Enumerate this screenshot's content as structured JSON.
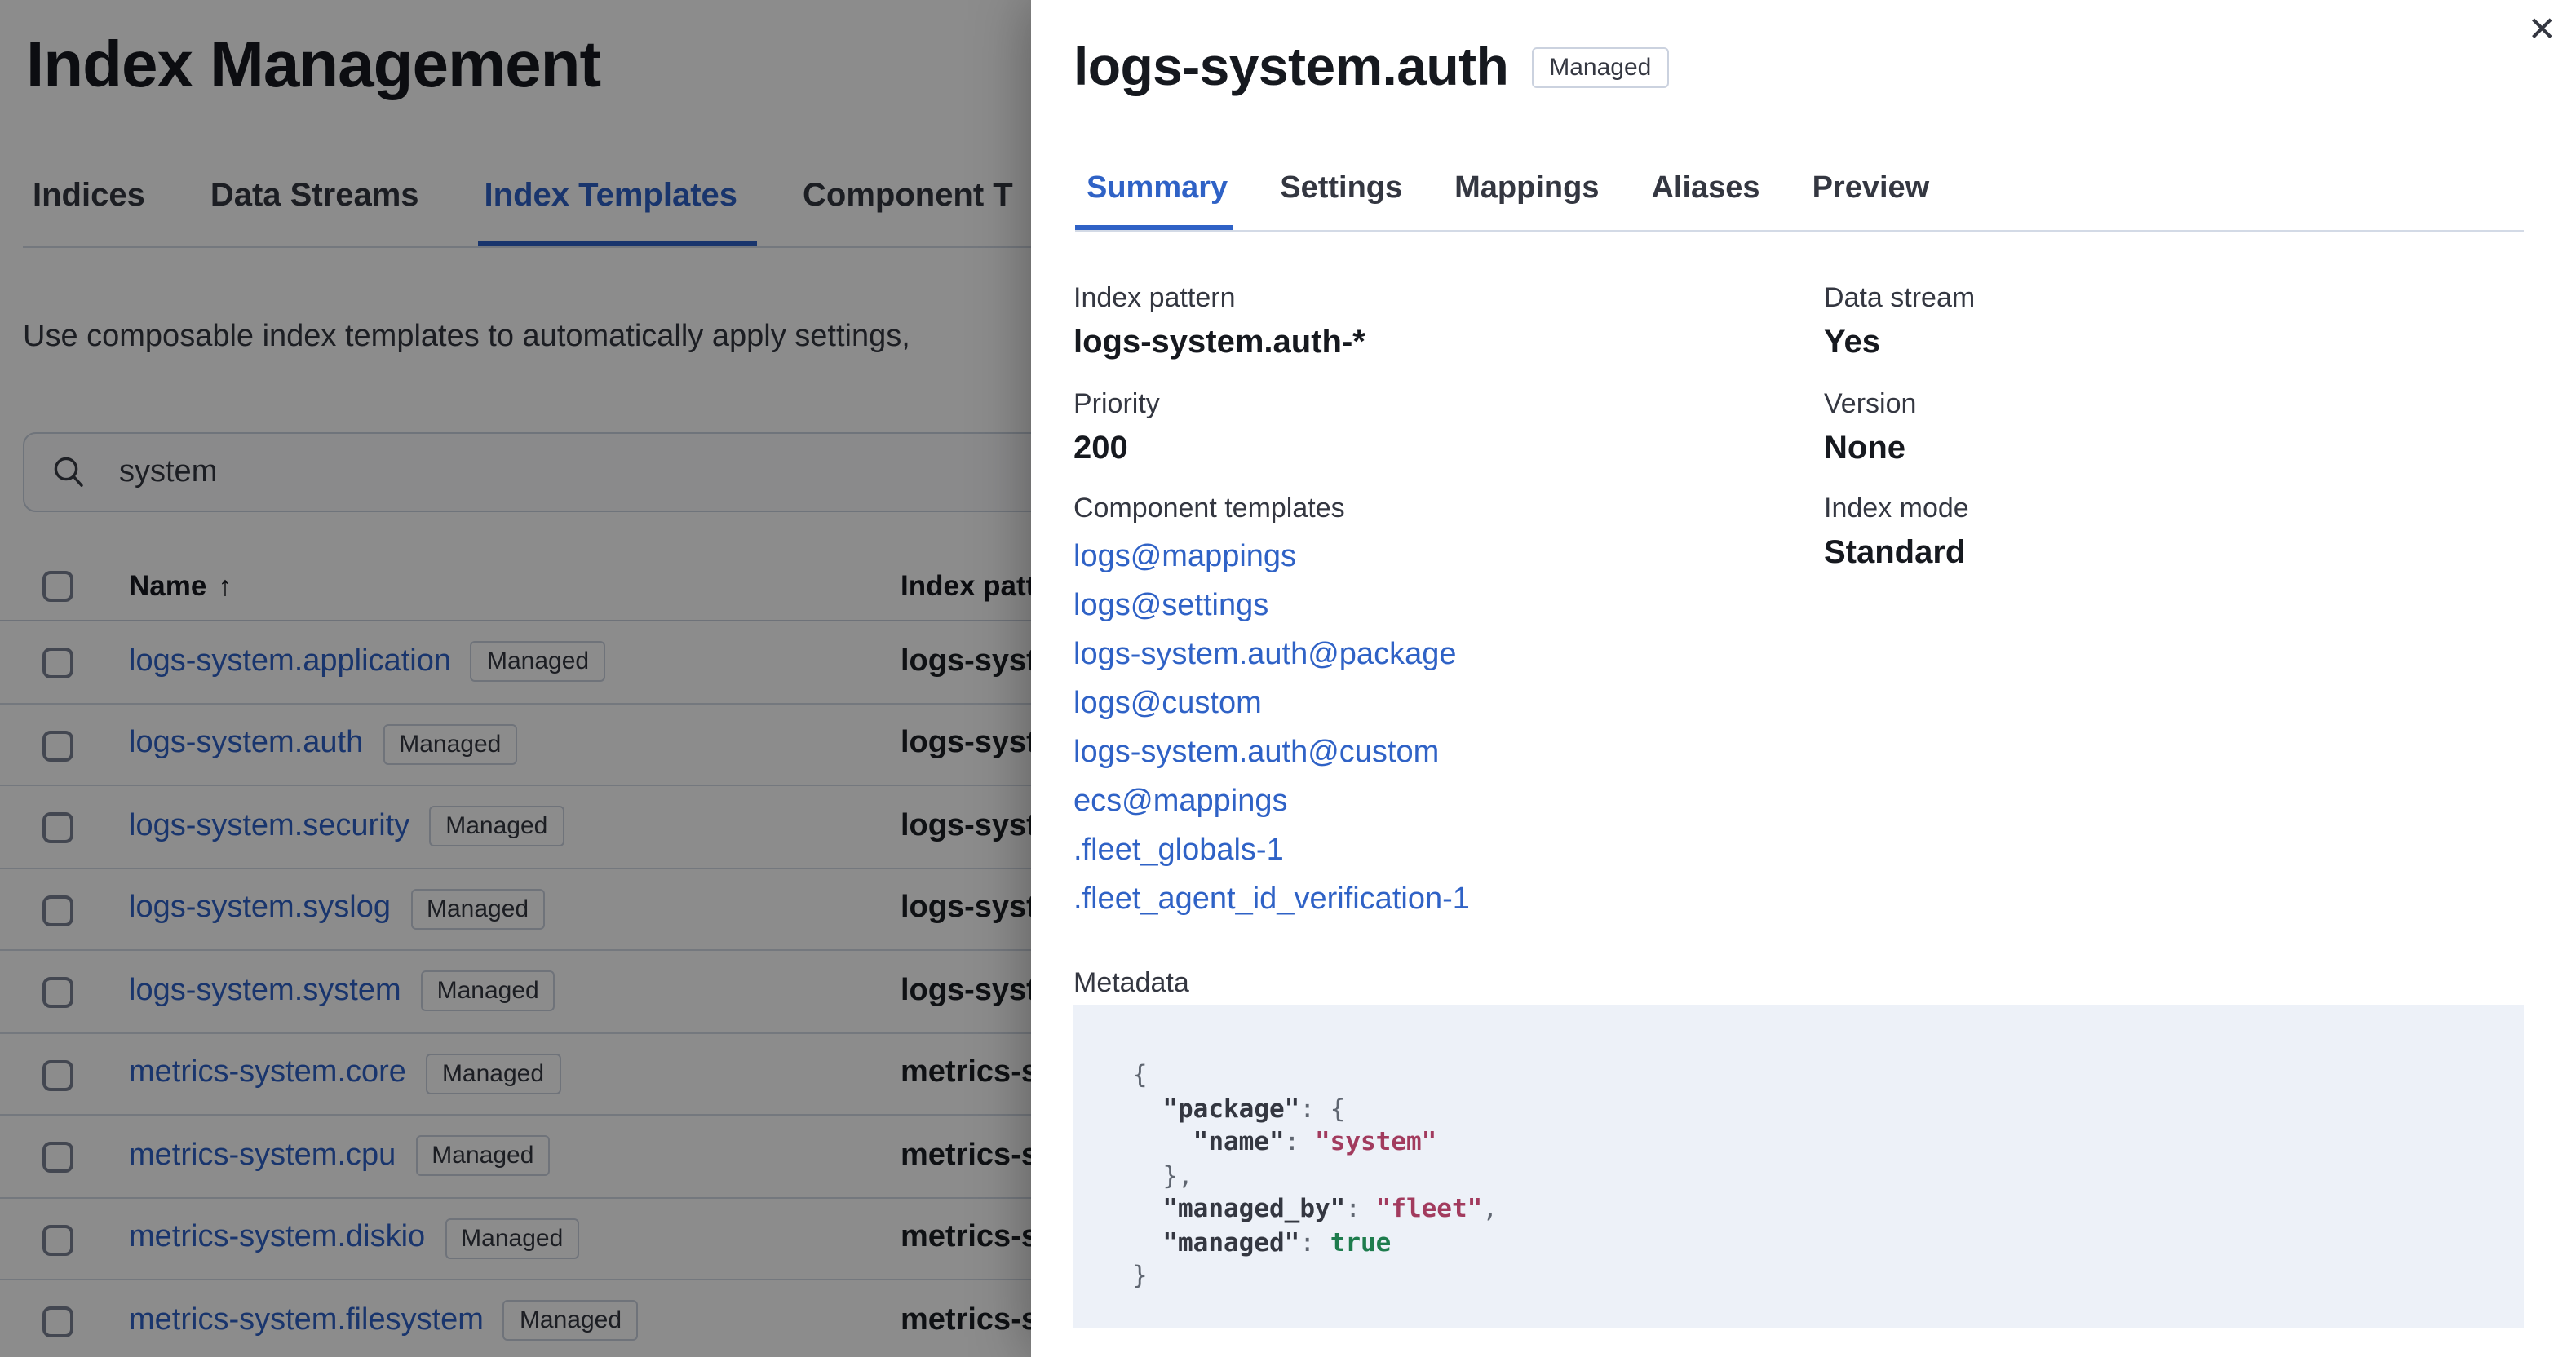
{
  "page": {
    "title": "Index Management",
    "tabs": [
      {
        "label": "Indices",
        "active": false
      },
      {
        "label": "Data Streams",
        "active": false
      },
      {
        "label": "Index Templates",
        "active": true
      },
      {
        "label": "Component T",
        "active": false
      }
    ],
    "description": "Use composable index templates to automatically apply settings,",
    "search": {
      "icon": "search-icon",
      "value": "system"
    },
    "table": {
      "columns": {
        "name": "Name",
        "index_pattern": "Index patter"
      },
      "sort_icon": "↑",
      "rows": [
        {
          "name": "logs-system.application",
          "badge": "Managed",
          "index_pattern": "logs-syste"
        },
        {
          "name": "logs-system.auth",
          "badge": "Managed",
          "index_pattern": "logs-syste"
        },
        {
          "name": "logs-system.security",
          "badge": "Managed",
          "index_pattern": "logs-syste"
        },
        {
          "name": "logs-system.syslog",
          "badge": "Managed",
          "index_pattern": "logs-syste"
        },
        {
          "name": "logs-system.system",
          "badge": "Managed",
          "index_pattern": "logs-syste"
        },
        {
          "name": "metrics-system.core",
          "badge": "Managed",
          "index_pattern": "metrics-sy"
        },
        {
          "name": "metrics-system.cpu",
          "badge": "Managed",
          "index_pattern": "metrics-sy"
        },
        {
          "name": "metrics-system.diskio",
          "badge": "Managed",
          "index_pattern": "metrics-sy"
        },
        {
          "name": "metrics-system.filesystem",
          "badge": "Managed",
          "index_pattern": "metrics-sy"
        }
      ]
    }
  },
  "flyout": {
    "close_icon": "✕",
    "title": "logs-system.auth",
    "badge": "Managed",
    "tabs": [
      {
        "label": "Summary",
        "active": true
      },
      {
        "label": "Settings",
        "active": false
      },
      {
        "label": "Mappings",
        "active": false
      },
      {
        "label": "Aliases",
        "active": false
      },
      {
        "label": "Preview",
        "active": false
      }
    ],
    "summary": {
      "index_pattern": {
        "label": "Index pattern",
        "value": "logs-system.auth-*"
      },
      "priority": {
        "label": "Priority",
        "value": "200"
      },
      "component_templates": {
        "label": "Component templates",
        "links": [
          "logs@mappings",
          "logs@settings",
          "logs-system.auth@package",
          "logs@custom",
          "logs-system.auth@custom",
          "ecs@mappings",
          ".fleet_globals-1",
          ".fleet_agent_id_verification-1"
        ]
      },
      "data_stream": {
        "label": "Data stream",
        "value": "Yes"
      },
      "version": {
        "label": "Version",
        "value": "None"
      },
      "index_mode": {
        "label": "Index mode",
        "value": "Standard"
      },
      "metadata": {
        "label": "Metadata",
        "code_lines": [
          [
            [
              "p",
              "{"
            ]
          ],
          [
            [
              "p",
              "  "
            ],
            [
              "k",
              "\"package\""
            ],
            [
              "p",
              ": {"
            ]
          ],
          [
            [
              "p",
              "    "
            ],
            [
              "k",
              "\"name\""
            ],
            [
              "p",
              ": "
            ],
            [
              "s",
              "\"system\""
            ]
          ],
          [
            [
              "p",
              "  },"
            ]
          ],
          [
            [
              "p",
              "  "
            ],
            [
              "k",
              "\"managed_by\""
            ],
            [
              "p",
              ": "
            ],
            [
              "s",
              "\"fleet\""
            ],
            [
              "p",
              ","
            ]
          ],
          [
            [
              "p",
              "  "
            ],
            [
              "k",
              "\"managed\""
            ],
            [
              "p",
              ": "
            ],
            [
              "b",
              "true"
            ]
          ],
          [
            [
              "p",
              "}"
            ]
          ]
        ]
      }
    }
  },
  "colors": {
    "accent_blue": "#2F62C6",
    "link_blue": "#2F62C6",
    "text_dark": "#16191F",
    "text_medium": "#343741",
    "divider": "#D3DAE6",
    "badge_border": "#CBD2DF",
    "code_background": "#EDF1F8",
    "code_string": "#A23B5E",
    "code_boolean": "#1E7C4D",
    "overlay": "rgba(0,0,0,0.45)"
  }
}
